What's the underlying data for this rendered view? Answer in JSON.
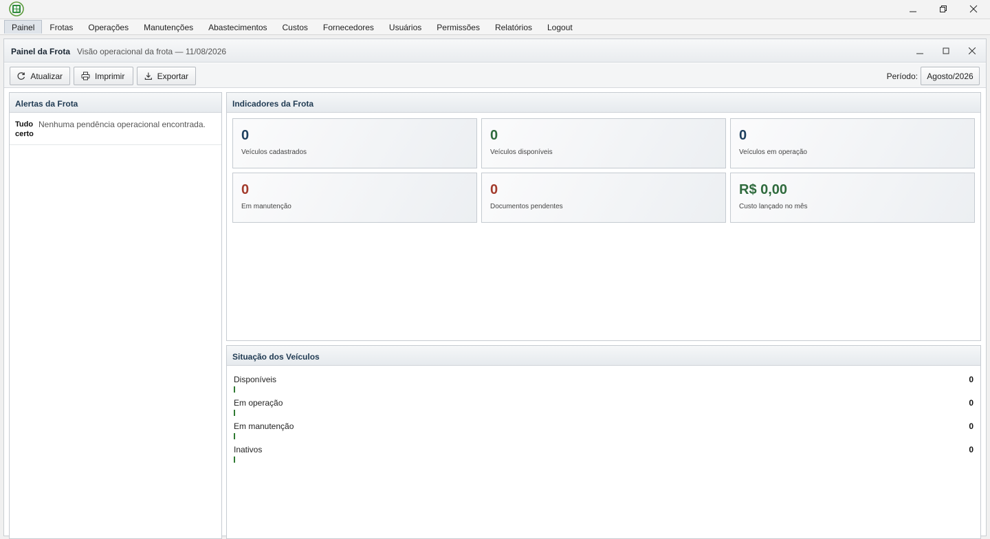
{
  "window": {
    "controls": [
      "minimize-icon",
      "restore-icon",
      "close-icon"
    ]
  },
  "menu": [
    {
      "label": "Painel",
      "active": true
    },
    {
      "label": "Frotas"
    },
    {
      "label": "Operações"
    },
    {
      "label": "Manutenções"
    },
    {
      "label": "Abastecimentos"
    },
    {
      "label": "Custos"
    },
    {
      "label": "Fornecedores"
    },
    {
      "label": "Usuários"
    },
    {
      "label": "Permissões"
    },
    {
      "label": "Relatórios"
    },
    {
      "label": "Logout"
    }
  ],
  "frame": {
    "title": "Painel da Frota",
    "subtitle": "Visão operacional da frota — 11/08/2026"
  },
  "toolbar": {
    "refresh_label": "Atualizar",
    "print_label": "Imprimir",
    "export_label": "Exportar",
    "period_label": "Período:",
    "period_value": "Agosto/2026"
  },
  "alerts": {
    "title": "Alertas da Frota",
    "items": [
      {
        "label": "Tudo certo",
        "message": "Nenhuma pendência operacional encontrada."
      }
    ]
  },
  "indicators": {
    "title": "Indicadores da Frota",
    "cards": [
      {
        "value": "0",
        "label": "Veículos cadastrados",
        "color": "#1d3f5e"
      },
      {
        "value": "0",
        "label": "Veículos disponíveis",
        "color": "#2f6b3d"
      },
      {
        "value": "0",
        "label": "Veículos em operação",
        "color": "#1d3f5e"
      },
      {
        "value": "0",
        "label": "Em manutenção",
        "color": "#a33b2c"
      },
      {
        "value": "0",
        "label": "Documentos pendentes",
        "color": "#a33b2c"
      },
      {
        "value": "R$ 0,00",
        "label": "Custo lançado no mês",
        "color": "#2f6b3d"
      }
    ]
  },
  "status": {
    "title": "Situação dos Veículos",
    "rows": [
      {
        "label": "Disponíveis",
        "value": "0"
      },
      {
        "label": "Em operação",
        "value": "0"
      },
      {
        "label": "Em manutenção",
        "value": "0"
      },
      {
        "label": "Inativos",
        "value": "0"
      }
    ],
    "bar_color": "#2f7a32"
  }
}
